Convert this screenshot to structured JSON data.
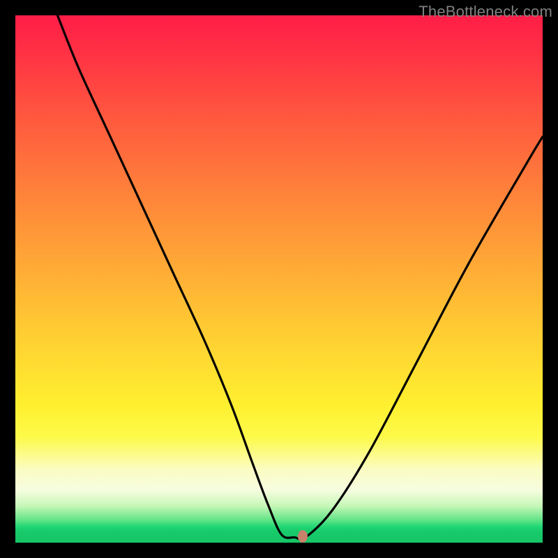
{
  "watermark": "TheBottleneck.com",
  "chart_data": {
    "type": "line",
    "title": "",
    "xlabel": "",
    "ylabel": "",
    "xlim": [
      0,
      100
    ],
    "ylim": [
      0,
      100
    ],
    "grid": false,
    "background_gradient": [
      "#ff1d47",
      "#ffab36",
      "#fdfa4a",
      "#18c96a"
    ],
    "series": [
      {
        "name": "bottleneck-curve",
        "x": [
          8,
          12,
          18,
          24,
          30,
          36,
          41,
          45,
          48,
          50.5,
          53,
          55,
          60,
          67,
          76,
          86,
          97,
          100
        ],
        "values": [
          100,
          90,
          77,
          64,
          51,
          38,
          26,
          15,
          7,
          1.5,
          1,
          1,
          6,
          17,
          34,
          53,
          72,
          77
        ]
      }
    ],
    "annotations": [
      {
        "name": "optimal-marker",
        "x": 54.5,
        "y": 1.2,
        "color": "#c8816b"
      }
    ]
  }
}
